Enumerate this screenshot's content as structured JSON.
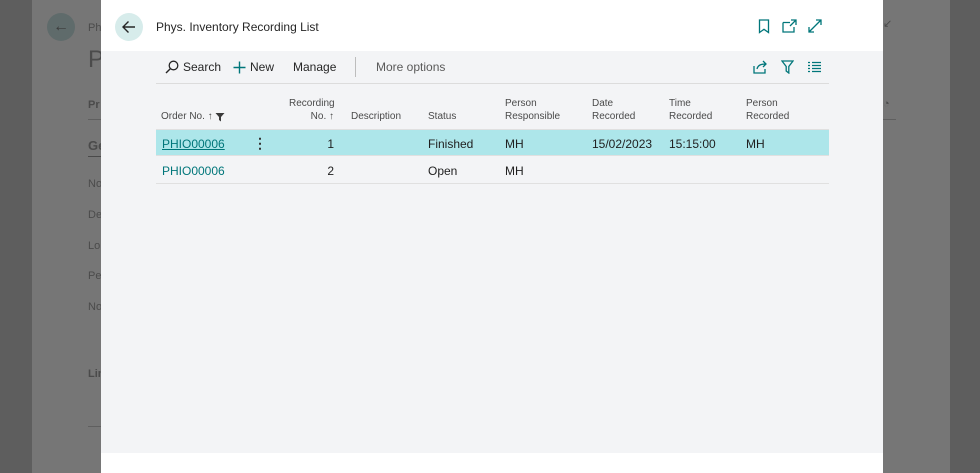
{
  "background": {
    "title_fragment": "P",
    "breadcrumb_fragment": "Ph",
    "tab_fragment": "Pr",
    "section_fragment": "Ge",
    "field_fragments": [
      "No",
      "De",
      "Lo",
      "Pe",
      "No"
    ],
    "lines_fragment": "Lin"
  },
  "dialog": {
    "title": "Phys. Inventory Recording List"
  },
  "toolbar": {
    "search_label": "Search",
    "new_label": "New",
    "manage_label": "Manage",
    "more_label": "More options"
  },
  "table": {
    "headers": {
      "order_no": "Order No. ↑",
      "recording_no_1": "Recording",
      "recording_no_2": "No. ↑",
      "description": "Description",
      "status": "Status",
      "person_responsible_1": "Person",
      "person_responsible_2": "Responsible",
      "date_recorded_1": "Date",
      "date_recorded_2": "Recorded",
      "time_recorded_1": "Time",
      "time_recorded_2": "Recorded",
      "person_recorded_1": "Person",
      "person_recorded_2": "Recorded"
    },
    "rows": [
      {
        "order_no": "PHIO00006",
        "recording_no": "1",
        "description": "",
        "status": "Finished",
        "person_responsible": "MH",
        "date_recorded": "15/02/2023",
        "time_recorded": "15:15:00",
        "person_recorded": "MH",
        "selected": true
      },
      {
        "order_no": "PHIO00006",
        "recording_no": "2",
        "description": "",
        "status": "Open",
        "person_responsible": "MH",
        "date_recorded": "",
        "time_recorded": "",
        "person_recorded": "",
        "selected": false
      }
    ]
  },
  "colors": {
    "accent": "#00767a",
    "selected_row": "#ade6ea",
    "back_button_bg": "#d7eceb"
  }
}
